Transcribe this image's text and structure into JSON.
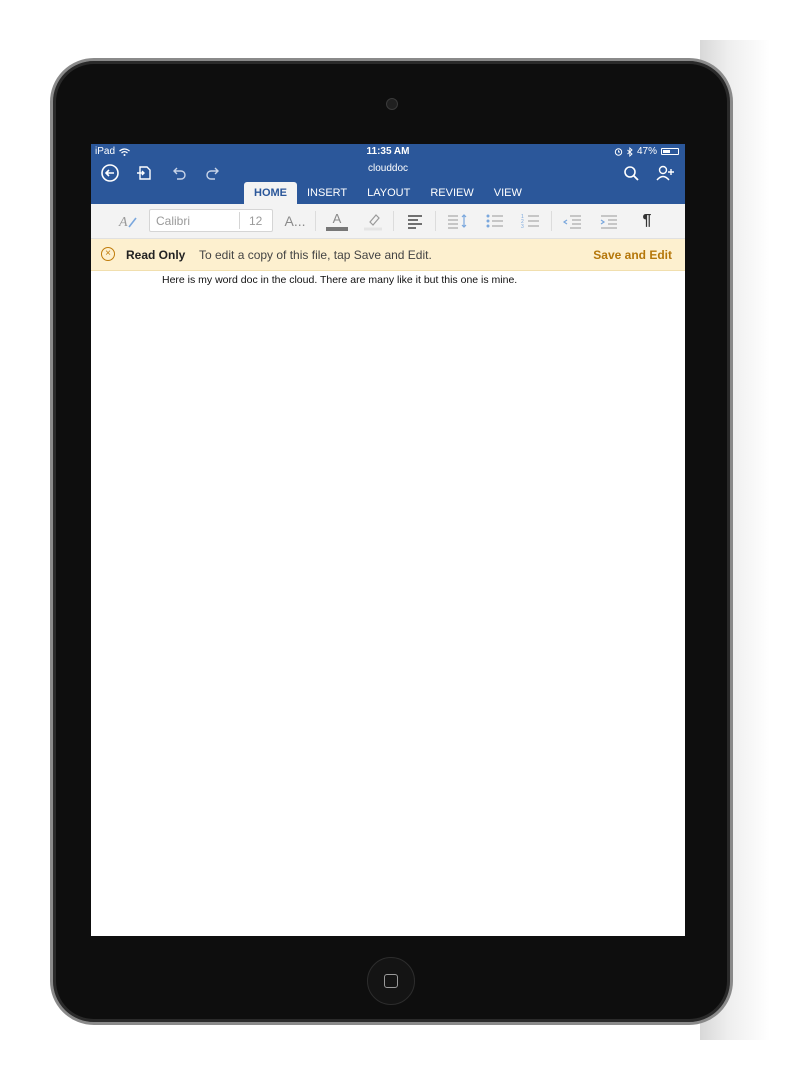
{
  "status_bar": {
    "device": "iPad",
    "time": "11:35 AM",
    "battery": "47%",
    "battery_level": 0.47
  },
  "header": {
    "doc_title": "clouddoc",
    "icons": [
      "back-icon",
      "save-copy-icon",
      "undo-icon",
      "redo-icon",
      "search-icon",
      "share-person-icon"
    ]
  },
  "tabs": [
    {
      "label": "HOME",
      "active": true
    },
    {
      "label": "INSERT",
      "active": false
    },
    {
      "label": "LAYOUT",
      "active": false
    },
    {
      "label": "REVIEW",
      "active": false
    },
    {
      "label": "VIEW",
      "active": false
    }
  ],
  "ribbon": {
    "font_name": "Calibri",
    "font_size": "12",
    "font_color_glyph": "A",
    "text_styles_glyph": "A...",
    "paragraph_glyph": "¶"
  },
  "banner": {
    "status": "Read Only",
    "message": "To edit a copy of this file, tap Save and Edit.",
    "action": "Save and Edit"
  },
  "document": {
    "text": "Here is my word doc in the cloud. There are many like it but this one is mine."
  },
  "colors": {
    "brand": "#2b579a",
    "banner_bg": "#fdf0cf",
    "action": "#b5770a"
  }
}
